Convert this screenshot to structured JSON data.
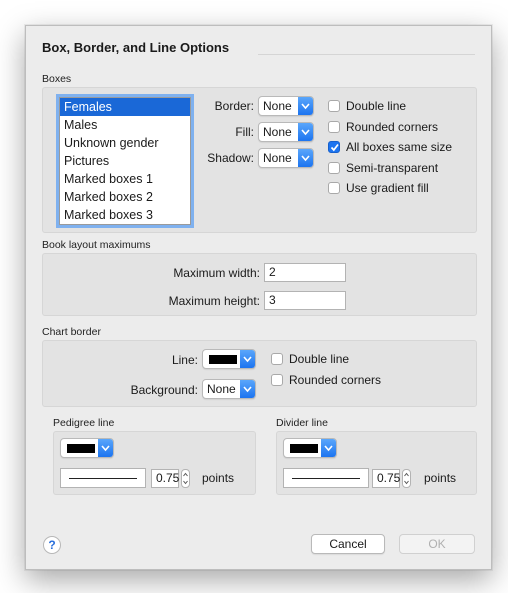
{
  "dialog": {
    "title": "Box, Border, and Line Options",
    "help_label": "?",
    "cancel_label": "Cancel",
    "ok_label": "OK"
  },
  "boxes": {
    "section_label": "Boxes",
    "list_items": [
      "Females",
      "Males",
      "Unknown gender",
      "Pictures",
      "Marked boxes 1",
      "Marked boxes 2",
      "Marked boxes 3"
    ],
    "selected_index": 0,
    "border_label": "Border:",
    "border_value": "None",
    "fill_label": "Fill:",
    "fill_value": "None",
    "shadow_label": "Shadow:",
    "shadow_value": "None",
    "checkboxes": [
      {
        "label": "Double line",
        "checked": false
      },
      {
        "label": "Rounded corners",
        "checked": false
      },
      {
        "label": "All boxes same size",
        "checked": true
      },
      {
        "label": "Semi-transparent",
        "checked": false
      },
      {
        "label": "Use gradient fill",
        "checked": false
      }
    ]
  },
  "book_layout": {
    "section_label": "Book layout maximums",
    "max_width_label": "Maximum width:",
    "max_width_value": "2",
    "max_height_label": "Maximum height:",
    "max_height_value": "3"
  },
  "chart_border": {
    "section_label": "Chart border",
    "line_label": "Line:",
    "line_color": "#000000",
    "background_label": "Background:",
    "background_value": "None",
    "double_line_label": "Double line",
    "double_line_checked": false,
    "rounded_corners_label": "Rounded corners",
    "rounded_corners_checked": false
  },
  "pedigree_line": {
    "section_label": "Pedigree line",
    "color": "#000000",
    "width_value": "0.75",
    "units_label": "points"
  },
  "divider_line": {
    "section_label": "Divider line",
    "color": "#000000",
    "width_value": "0.75",
    "units_label": "points"
  },
  "colors": {
    "accent": "#1c74f0",
    "selection": "#1a68d7"
  }
}
